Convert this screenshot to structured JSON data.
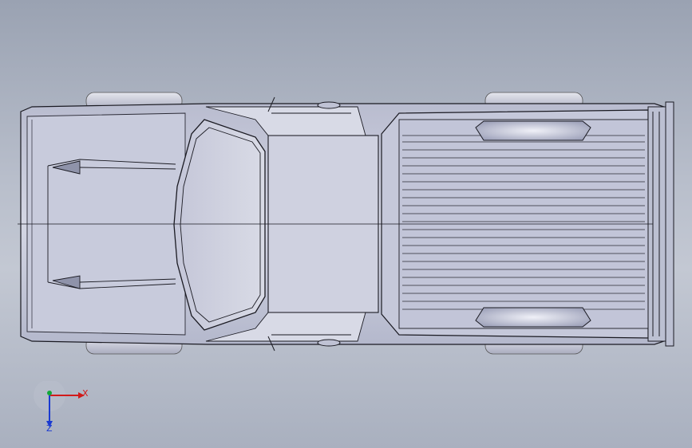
{
  "viewport": {
    "model": "pickup-truck-top-view",
    "colors": {
      "background_top": "#9aa2b2",
      "background_mid": "#c3c8d3",
      "body": "#c9ccdc",
      "body_shade": "#aeb2c6",
      "edge": "#1a1a22",
      "axis_x": "#d11a1a",
      "axis_y": "#12a83a",
      "axis_z": "#1a3ad1"
    }
  },
  "triad": {
    "x_label": "X",
    "z_label": "Z",
    "icon": "coordinate-triad-icon"
  }
}
